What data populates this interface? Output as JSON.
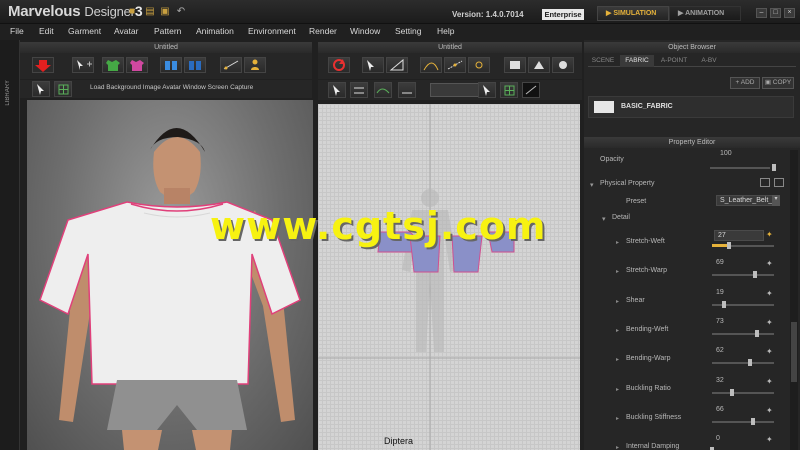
{
  "app": {
    "name_part1": "Marvelous",
    "name_part2": "Designer",
    "name_part3": "3",
    "version": "Version:  1.4.0.7014",
    "edition": "Enterprise",
    "modes": [
      "SIMULATION",
      "ANIMATION"
    ]
  },
  "menu": [
    "File",
    "Edit",
    "Garment",
    "Avatar",
    "Pattern",
    "Animation",
    "Environment",
    "Render",
    "Window",
    "Setting",
    "Help"
  ],
  "library_label": "LIBRARY",
  "view3d": {
    "title": "Untitled",
    "toolbar2_text": "Load Background Image  Avatar Window Screen Capture"
  },
  "view2d": {
    "title": "Untitled",
    "bottom_label": "Diptera"
  },
  "object_browser": {
    "title": "Object Browser",
    "tabs": [
      "SCENE",
      "FABRIC",
      "A-POINT",
      "A-BV"
    ],
    "add_label": "ADD",
    "copy_label": "COPY",
    "fabric_name": "BASIC_FABRIC"
  },
  "property_editor": {
    "title": "Property Editor",
    "opacity_label": "Opacity",
    "opacity_value": "100",
    "physical_property_label": "Physical Property",
    "preset_label": "Preset",
    "preset_value": "S_Leather_Belt_",
    "detail_label": "Detail",
    "properties": [
      {
        "label": "Stretch-Weft",
        "value": "27",
        "level": 0.27
      },
      {
        "label": "Stretch-Warp",
        "value": "69",
        "level": 0.69
      },
      {
        "label": "Shear",
        "value": "19",
        "level": 0.19
      },
      {
        "label": "Bending-Weft",
        "value": "73",
        "level": 0.73
      },
      {
        "label": "Bending-Warp",
        "value": "62",
        "level": 0.62
      },
      {
        "label": "Buckling Ratio",
        "value": "32",
        "level": 0.32
      },
      {
        "label": "Buckling Stiffness",
        "value": "66",
        "level": 0.66
      },
      {
        "label": "Internal Damping",
        "value": "0",
        "level": 0.0
      }
    ]
  },
  "watermark": "www.cgtsj.com",
  "colors": {
    "accent": "#e6b23a",
    "watermark": "#f7f211",
    "seam": "#e0407a"
  }
}
